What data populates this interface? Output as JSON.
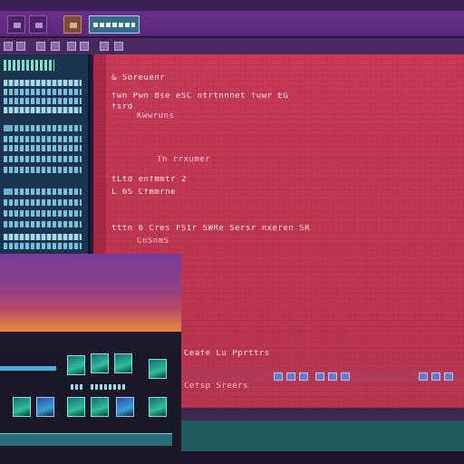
{
  "editor": {
    "lines": [
      "& Soreuenr",
      "fwn  Pwn  Bse  eSC  ntrtnnnet  fuwr  EG",
      "fsrd",
      "Kwwruns",
      "Tn  rrxumer",
      "tLtd  enfmmtr  2",
      "L  6S  Cfmmrne",
      "tttn  6  Cres  FSIr  SWRe  Sersr  nxeren  SR",
      "CnSnmS"
    ],
    "bottom_lines": [
      "Ceafe  Lu  Pprttrs",
      "Cefsp  Sreers"
    ]
  }
}
